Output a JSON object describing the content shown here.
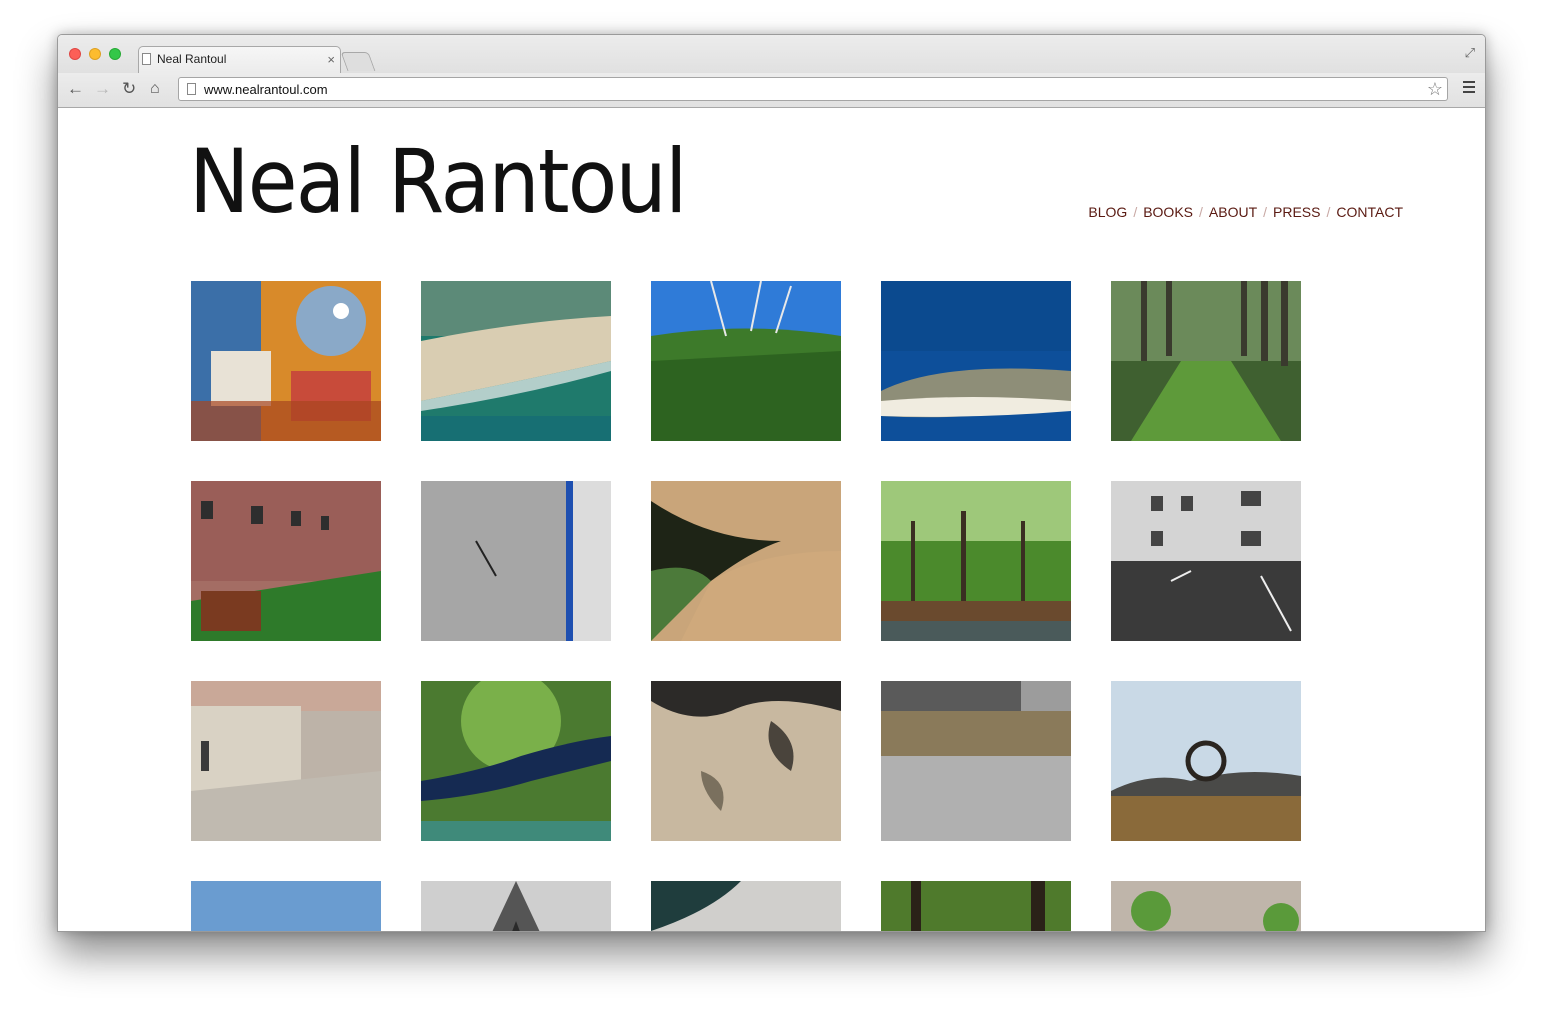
{
  "browser": {
    "tab_title": "Neal Rantoul",
    "tab_close": "×",
    "url": "www.nealrantoul.com"
  },
  "site": {
    "title": "Neal Rantoul",
    "nav": [
      "BLOG",
      "BOOKS",
      "ABOUT",
      "PRESS",
      "CONTACT"
    ]
  },
  "colors": {
    "nav_link": "#5a1a12",
    "title": "#111111"
  },
  "gallery": {
    "columns": 5,
    "rows_visible": 4,
    "thumbnails": [
      "graffiti-mural",
      "aerial-coastline",
      "hedge-and-sky",
      "sand-spit-blue-sea",
      "tree-row-forest",
      "weathered-brick-wall",
      "grain-silo",
      "wheat-field-curve",
      "green-forest-pond",
      "motel-parking-lot",
      "rooftop-alley",
      "aerial-river-marsh",
      "sand-dunes",
      "flooded-building",
      "driftwood-sculpture",
      "sky-horizon",
      "barn-roof",
      "aerial-shoreline",
      "forest-trunks",
      "gravel-plants"
    ]
  }
}
